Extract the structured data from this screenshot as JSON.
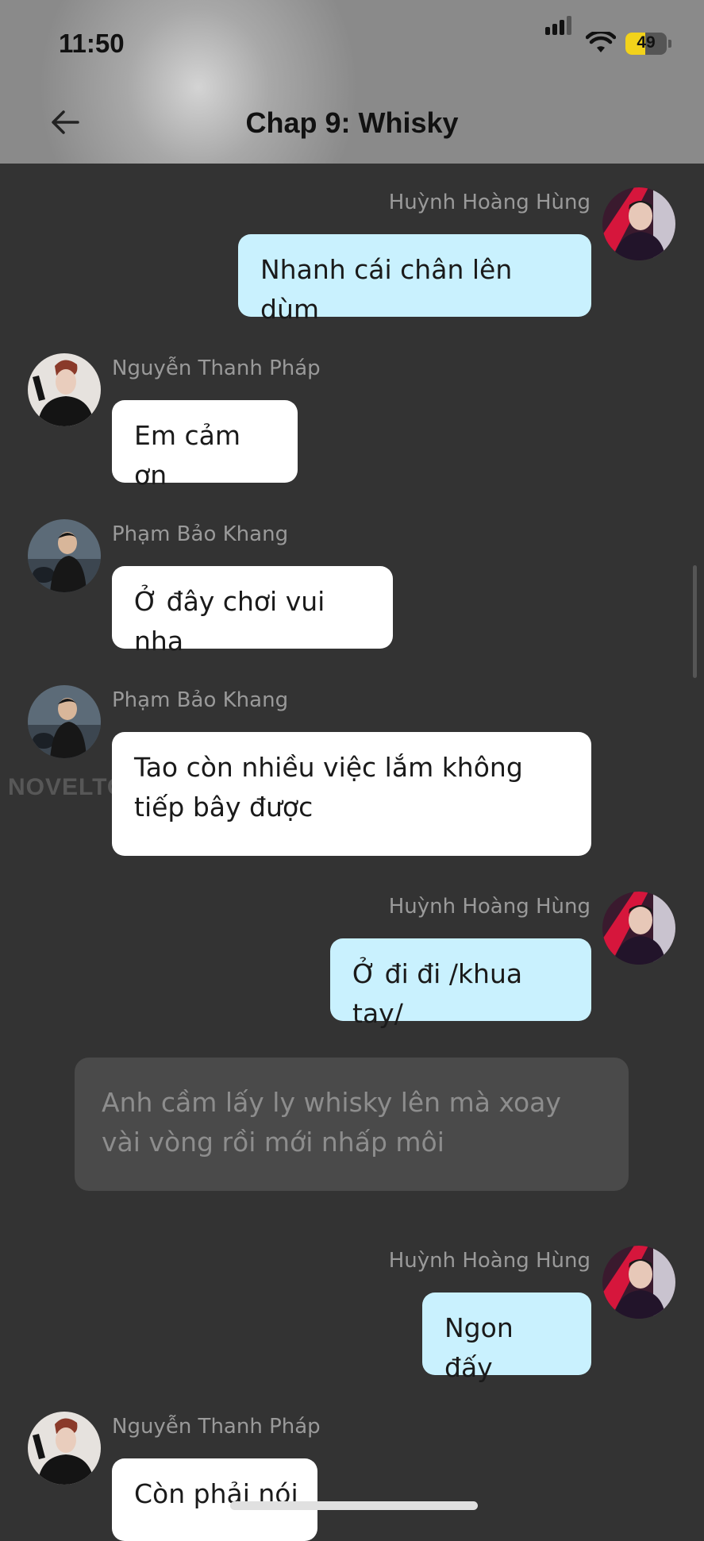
{
  "status": {
    "time": "11:50",
    "battery": "49",
    "battery_level": 0.49
  },
  "header": {
    "title": "Chap 9: Whisky"
  },
  "messages": [
    {
      "sender": "Huỳnh Hoàng Hùng",
      "text": "Nhanh cái chân lên dùm",
      "side": "right"
    },
    {
      "sender": "Nguyễn Thanh Pháp",
      "text": "Em cảm ơn",
      "side": "left"
    },
    {
      "sender": "Phạm Bảo Khang",
      "text": "Ở đây chơi vui nha",
      "side": "left"
    },
    {
      "sender": "Phạm Bảo Khang",
      "text": "Tao còn nhiều việc lắm không tiếp bây được",
      "side": "left"
    },
    {
      "sender": "Huỳnh Hoàng Hùng",
      "text": "Ở đi đi /khua tay/",
      "side": "right"
    },
    {
      "sender": "Huỳnh Hoàng Hùng",
      "text": "Ngon đấy",
      "side": "right"
    },
    {
      "sender": "Nguyễn Thanh Pháp",
      "text": "Còn phải nói",
      "side": "left"
    }
  ],
  "narration": {
    "text": "Anh cầm lấy ly whisky lên mà xoay vài vòng rồi mới nhấp môi"
  },
  "watermark": "NOVELTOON",
  "colors": {
    "me_bubble": "#c9f1fe",
    "other_bubble": "#ffffff",
    "background": "#333333",
    "battery": "#f2d21b"
  }
}
